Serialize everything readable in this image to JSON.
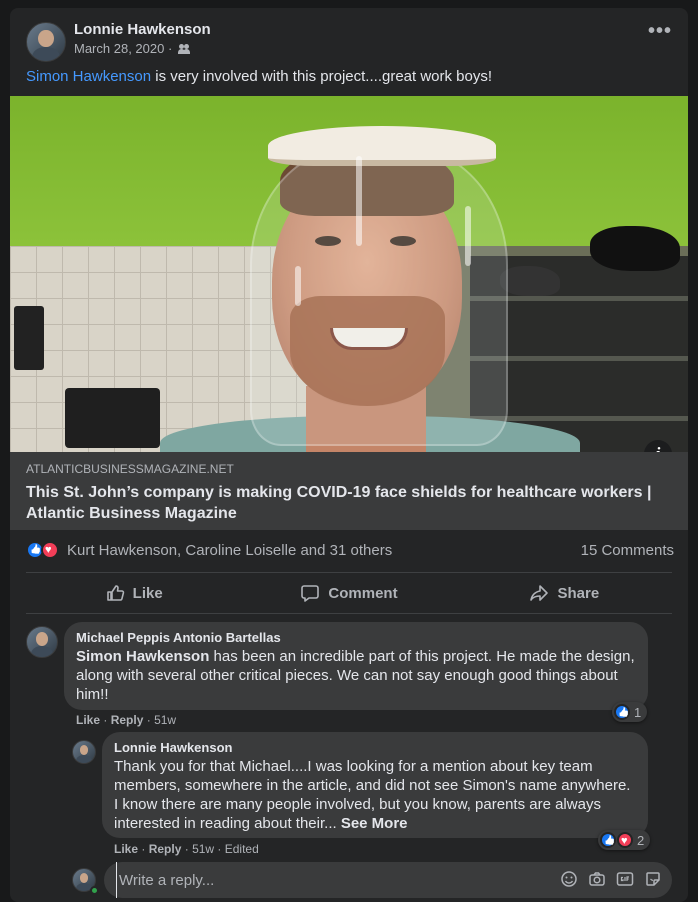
{
  "post": {
    "author": "Lonnie Hawkenson",
    "date": "March 28, 2020 ·",
    "privacy_icon": "friends-icon",
    "more_label": "•••",
    "caption_mention": "Simon Hawkenson",
    "caption_text": " is very involved with this project....great work boys!",
    "info_label": "i"
  },
  "link": {
    "domain": "ATLANTICBUSINESSMAGAZINE.NET",
    "title": "This St. John’s company is making COVID-19 face shields for healthcare workers | Atlantic Business Magazine"
  },
  "reactions": {
    "names": "Kurt Hawkenson, Caroline Loiselle and 31 others",
    "comments": "15 Comments"
  },
  "actions": {
    "like": "Like",
    "comment": "Comment",
    "share": "Share"
  },
  "comments": [
    {
      "name": "Michael Peppis Antonio Bartellas",
      "mention": "Simon Hawkenson",
      "text": " has been an incredible part of this project. He made the design, along with several other critical pieces. We can not say enough good things about him!!",
      "like": "Like",
      "reply": "Reply",
      "time": "· 51w",
      "sep": "·",
      "reaction_count": "1"
    },
    {
      "name": "Lonnie Hawkenson",
      "text": "Thank you for that Michael....I was looking for a mention about key team members, somewhere in the article, and did not see Simon's name anywhere. I know there are many people involved, but you know, parents are always interested in reading about their... ",
      "see_more": "See More",
      "like": "Like",
      "reply": "Reply",
      "time": "· 51w",
      "edited": "· Edited",
      "sep": "·",
      "reaction_count": "2"
    }
  ],
  "reply": {
    "placeholder": "Write a reply..."
  },
  "colors": {
    "background": "#18191a",
    "card": "#242526",
    "bubble": "#3a3b3c",
    "link": "#4599ff",
    "like": "#1877f2",
    "love": "#f33e58"
  }
}
